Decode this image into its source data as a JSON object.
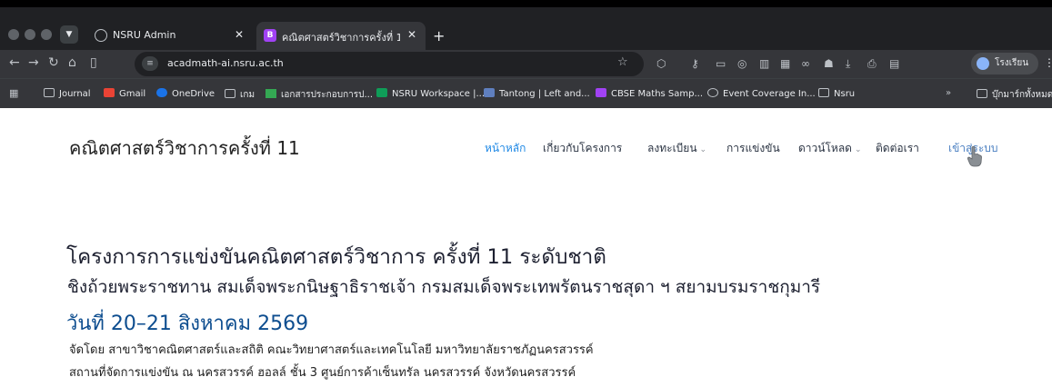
{
  "browser": {
    "tabs": [
      {
        "title": "NSRU Admin",
        "favicon": "globe-icon"
      },
      {
        "title": "คณิตศาสตร์วิชาการครั้งที่ 11 - ระ",
        "favicon": "B",
        "favicon_color": "#a142f4"
      }
    ],
    "url": "acadmath-ai.nsru.ac.th",
    "profile_label": "โรงเรียน",
    "bookmarks": [
      {
        "label": "Journal",
        "icon": "folder-icon"
      },
      {
        "label": "Gmail",
        "icon": "gmail-icon"
      },
      {
        "label": "OneDrive",
        "icon": "onedrive-icon"
      },
      {
        "label": "เกม",
        "icon": "folder-icon"
      },
      {
        "label": "เอกสารประกอบการป...",
        "icon": "drive-icon"
      },
      {
        "label": "NSRU Workspace |...",
        "icon": "workspace-icon"
      },
      {
        "label": "Tantong | Left and...",
        "icon": "tantong-icon"
      },
      {
        "label": "CBSE Maths Samp...",
        "icon": "cbse-icon"
      },
      {
        "label": "Event Coverage In...",
        "icon": "globe-icon"
      },
      {
        "label": "Nsru",
        "icon": "folder-icon"
      }
    ],
    "all_bookmarks_label": "บุ๊กมาร์กทั้งหมด"
  },
  "site": {
    "title": "คณิตศาสตร์วิชาการครั้งที่ 11",
    "menu": [
      {
        "label": "หน้าหลัก",
        "active": true
      },
      {
        "label": "เกี่ยวกับโครงการ"
      },
      {
        "label": "ลงทะเบียน",
        "dropdown": true
      },
      {
        "label": "การแข่งขัน"
      },
      {
        "label": "ดาวน์โหลด",
        "dropdown": true
      },
      {
        "label": "ติดต่อเรา"
      },
      {
        "label": "เข้าสู่ระบบ",
        "link": true
      }
    ],
    "accent_color": "#1e88e5"
  },
  "hero": {
    "heading": "โครงการการแข่งขันคณิตศาสตร์วิชาการ ครั้งที่ 11 ระดับชาติ",
    "subheading": "ชิงถ้วยพระราชทาน สมเด็จพระกนิษฐาธิราชเจ้า กรมสมเด็จพระเทพรัตนราชสุดา ฯ สยามบรมราชกุมารี",
    "date": "วันที่ 20–21 สิงหาคม 2569",
    "organizer": "จัดโดย สาขาวิชาคณิตศาสตร์และสถิติ คณะวิทยาศาสตร์และเทคโนโลยี มหาวิทยาลัยราชภัฏนครสวรรค์",
    "venue": "สถานที่จัดการแข่งขัน ณ นครสวรรค์ ฮอลล์ ชั้น 3 ศูนย์การค้าเซ็นทรัล นครสวรรค์ จังหวัดนครสวรรค์"
  }
}
